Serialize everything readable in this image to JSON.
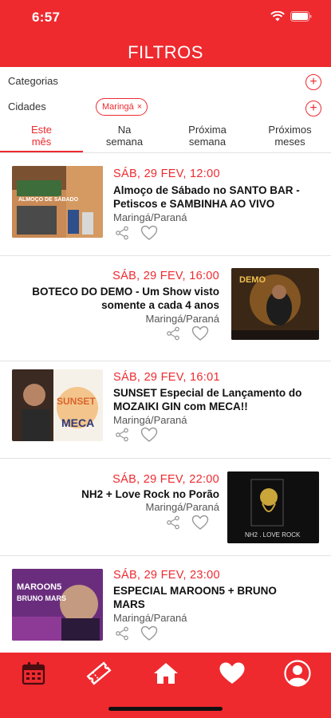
{
  "status_bar": {
    "time": "6:57"
  },
  "header": {
    "title": "FILTROS"
  },
  "filters": {
    "categories_label": "Categorias",
    "cities_label": "Cidades",
    "city_chip": "Maringá",
    "chip_remove": "×",
    "add_symbol": "+"
  },
  "tabs": [
    {
      "line1": "Este",
      "line2": "mês",
      "active": true
    },
    {
      "line1": "Na",
      "line2": "semana",
      "active": false
    },
    {
      "line1": "Próxima",
      "line2": "semana",
      "active": false
    },
    {
      "line1": "Próximos",
      "line2": "meses",
      "active": false
    }
  ],
  "events": [
    {
      "date": "SÁB, 29 FEV, 12:00",
      "title": "Almoço de Sábado no SANTO BAR - Petiscos e SAMBINHA AO VIVO",
      "city": "Maringá/Paraná",
      "poster_text": "ALMOÇO DE SÁBADO"
    },
    {
      "date": "SÁB, 29 FEV, 16:00",
      "title": "BOTECO DO DEMO - Um Show visto somente a cada  4 anos",
      "city": "Maringá/Paraná",
      "poster_text": "DEMO"
    },
    {
      "date": "SÁB, 29 FEV, 16:01",
      "title": "SUNSET Especial de Lançamento do MOZAIKI GIN com MECA!!",
      "city": "Maringá/Paraná",
      "poster_text": "SUNSET",
      "poster_sub": "MECA"
    },
    {
      "date": "SÁB, 29 FEV, 22:00",
      "title": "NH2 + Love Rock no Porão",
      "city": "Maringá/Paraná",
      "poster_text": "NH2 . LOVE ROCK"
    },
    {
      "date": "SÁB, 29 FEV, 23:00",
      "title": "ESPECIAL MAROON5 + BRUNO MARS",
      "city": "Maringá/Paraná",
      "poster_text": "MAROON5",
      "poster_sub": "BRUNO MARS"
    }
  ],
  "colors": {
    "accent": "#ee2a2f",
    "text": "#111111",
    "muted": "#555555"
  },
  "bottom_nav": [
    "calendar-icon",
    "ticket-icon",
    "home-icon",
    "heart-icon",
    "profile-icon"
  ]
}
